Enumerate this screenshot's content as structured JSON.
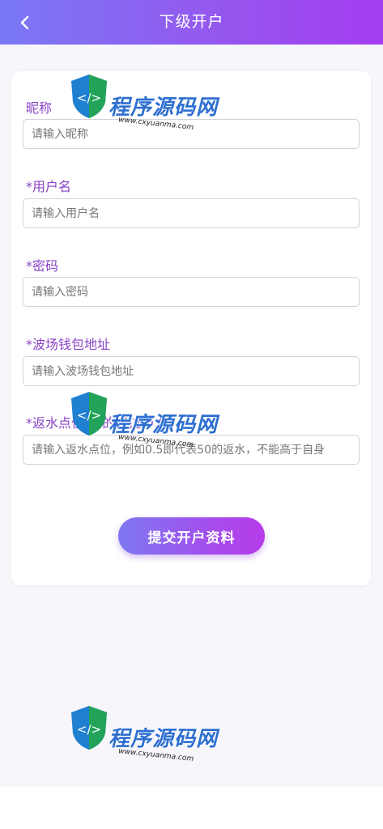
{
  "header": {
    "title": "下级开户"
  },
  "form": {
    "nickname": {
      "label": "昵称",
      "required": false,
      "placeholder": "请输入昵称"
    },
    "username": {
      "label": "用户名",
      "required": true,
      "placeholder": "请输入用户名"
    },
    "password": {
      "label": "密码",
      "required": true,
      "placeholder": "请输入密码"
    },
    "wallet": {
      "label": "波场钱包地址",
      "required": true,
      "placeholder": "请输入波场钱包地址"
    },
    "rebate": {
      "label": "返水点位(百的点位:0.0)",
      "required": true,
      "placeholder": "请输入返水点位，例如0.5即代表50的返水，不能高于自身"
    },
    "required_mark": "*",
    "submit_label": "提交开户资料"
  },
  "watermark": {
    "brand": "程序源码网",
    "url": "www.cxyuanma.com"
  },
  "colors": {
    "header_start": "#7a79f6",
    "header_end": "#a43df0",
    "label": "#8a44c7",
    "page_bg": "#f6f6fb"
  }
}
